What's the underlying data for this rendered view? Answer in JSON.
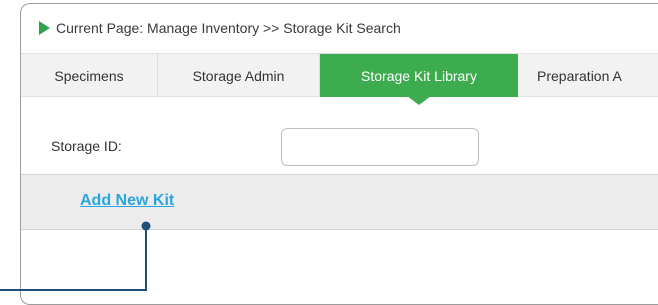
{
  "breadcrumb": {
    "text": "Current Page: Manage Inventory >> Storage Kit Search"
  },
  "tabs": [
    {
      "label": "Specimens"
    },
    {
      "label": "Storage Admin"
    },
    {
      "label": "Storage Kit Library",
      "active": true
    },
    {
      "label": "Preparation A"
    }
  ],
  "search": {
    "storage_id_label": "Storage ID:",
    "storage_id_value": ""
  },
  "actions": {
    "add_new_kit_label": "Add New Kit"
  },
  "colors": {
    "accent_green": "#3dac4f",
    "link_blue": "#2aa6df",
    "callout_navy": "#1f4e7a"
  }
}
